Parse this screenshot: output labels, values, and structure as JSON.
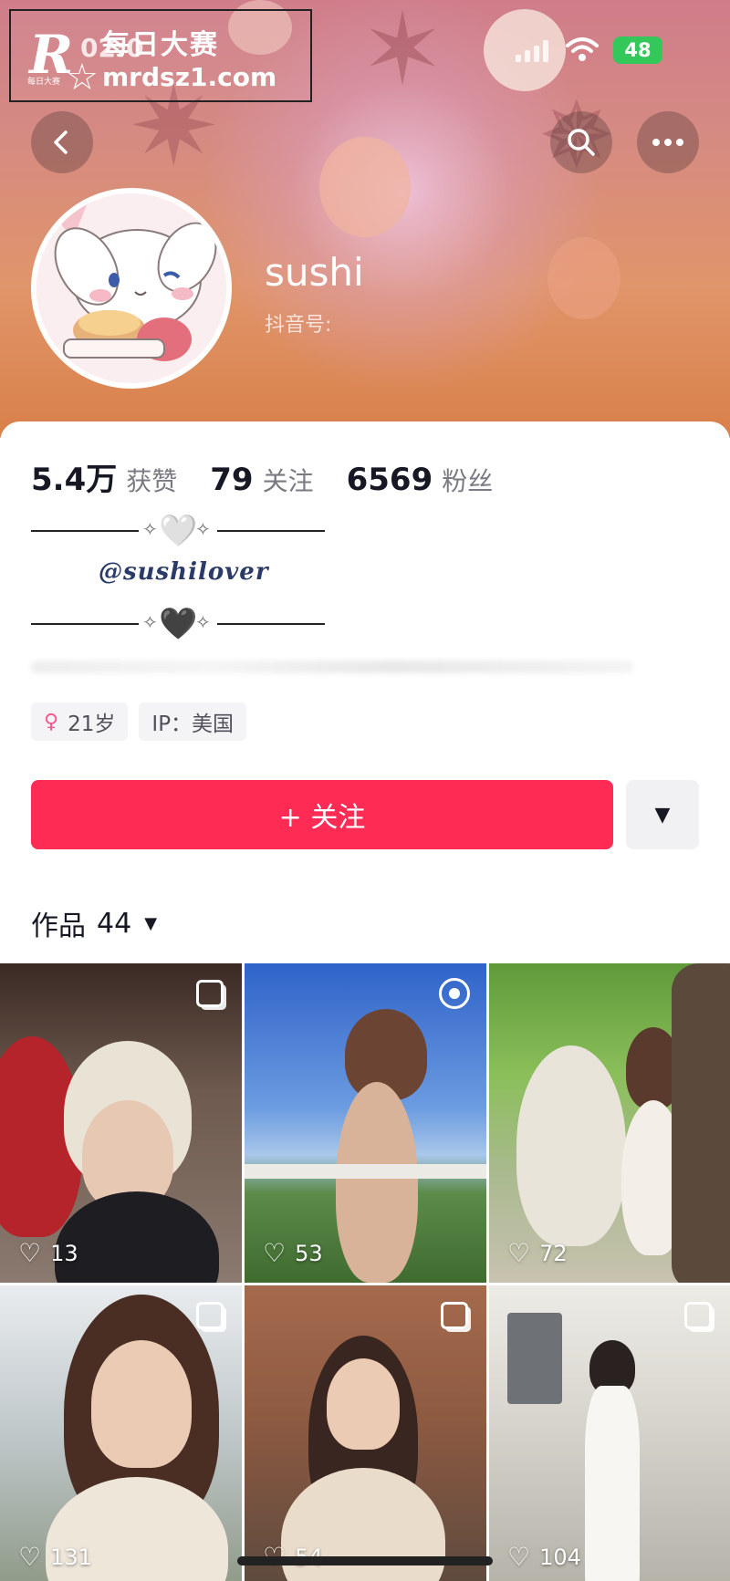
{
  "watermark": {
    "logo_letter": "R",
    "logo_small": "每日大赛",
    "title": "每日大赛",
    "url": "mrdsz1.com"
  },
  "status_bar": {
    "time": "02:0",
    "battery": "48"
  },
  "header": {
    "back_icon": "chevron-left-icon",
    "search_icon": "search-icon",
    "more_icon": "more-dots-icon"
  },
  "profile": {
    "username": "sushi",
    "douyin_id_label": "抖音号:",
    "signature": "@sushilover",
    "divider_heart_top": "🤍",
    "divider_heart_bottom": "🖤",
    "sparkle": "✧"
  },
  "stats": [
    {
      "value": "5.4万",
      "label": "获赞"
    },
    {
      "value": "79",
      "label": "关注"
    },
    {
      "value": "6569",
      "label": "粉丝"
    }
  ],
  "tags": [
    {
      "icon": "female-icon",
      "text": "21岁"
    },
    {
      "text": "IP：美国"
    }
  ],
  "actions": {
    "follow_label": "+ 关注",
    "dropdown_icon": "caret-down-icon"
  },
  "works": {
    "label": "作品",
    "count": "44"
  },
  "videos": [
    {
      "likes": "13",
      "badge": "multi"
    },
    {
      "likes": "53",
      "badge": "live"
    },
    {
      "likes": "72",
      "badge": "none"
    },
    {
      "likes": "131",
      "badge": "multi"
    },
    {
      "likes": "54",
      "badge": "multi"
    },
    {
      "likes": "104",
      "badge": "multi"
    }
  ],
  "colors": {
    "accent": "#fe2c55",
    "battery": "#34c759"
  }
}
